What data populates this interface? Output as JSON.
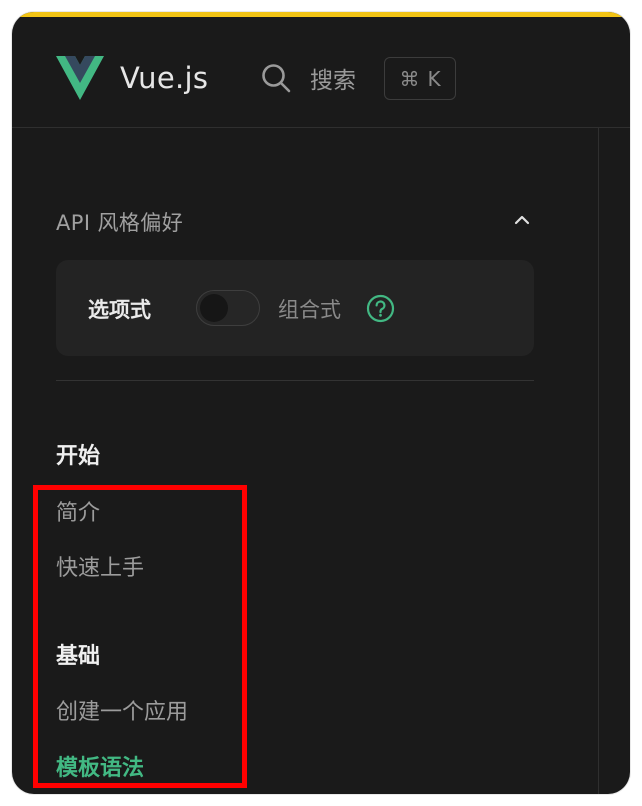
{
  "colors": {
    "accent": "#42b883",
    "top_bar": "#f2c415",
    "highlight_border": "#ff0000",
    "background": "#1a1a1a"
  },
  "header": {
    "logo_icon": "vue-logo-icon",
    "brand": "Vue.js",
    "search_icon": "search-icon",
    "search_label": "搜索",
    "shortcut_symbol": "⌘",
    "shortcut_key": "K"
  },
  "api_style": {
    "label": "API 风格偏好",
    "collapse_icon": "chevron-up-icon",
    "option_left": "选项式",
    "option_right": "组合式",
    "toggle_on": false,
    "help_icon": "question-circle-icon"
  },
  "sidebar": {
    "sections": [
      {
        "title": "开始",
        "items": [
          {
            "label": "简介",
            "active": false
          },
          {
            "label": "快速上手",
            "active": false
          }
        ]
      },
      {
        "title": "基础",
        "items": [
          {
            "label": "创建一个应用",
            "active": false
          },
          {
            "label": "模板语法",
            "active": true
          }
        ]
      }
    ]
  }
}
